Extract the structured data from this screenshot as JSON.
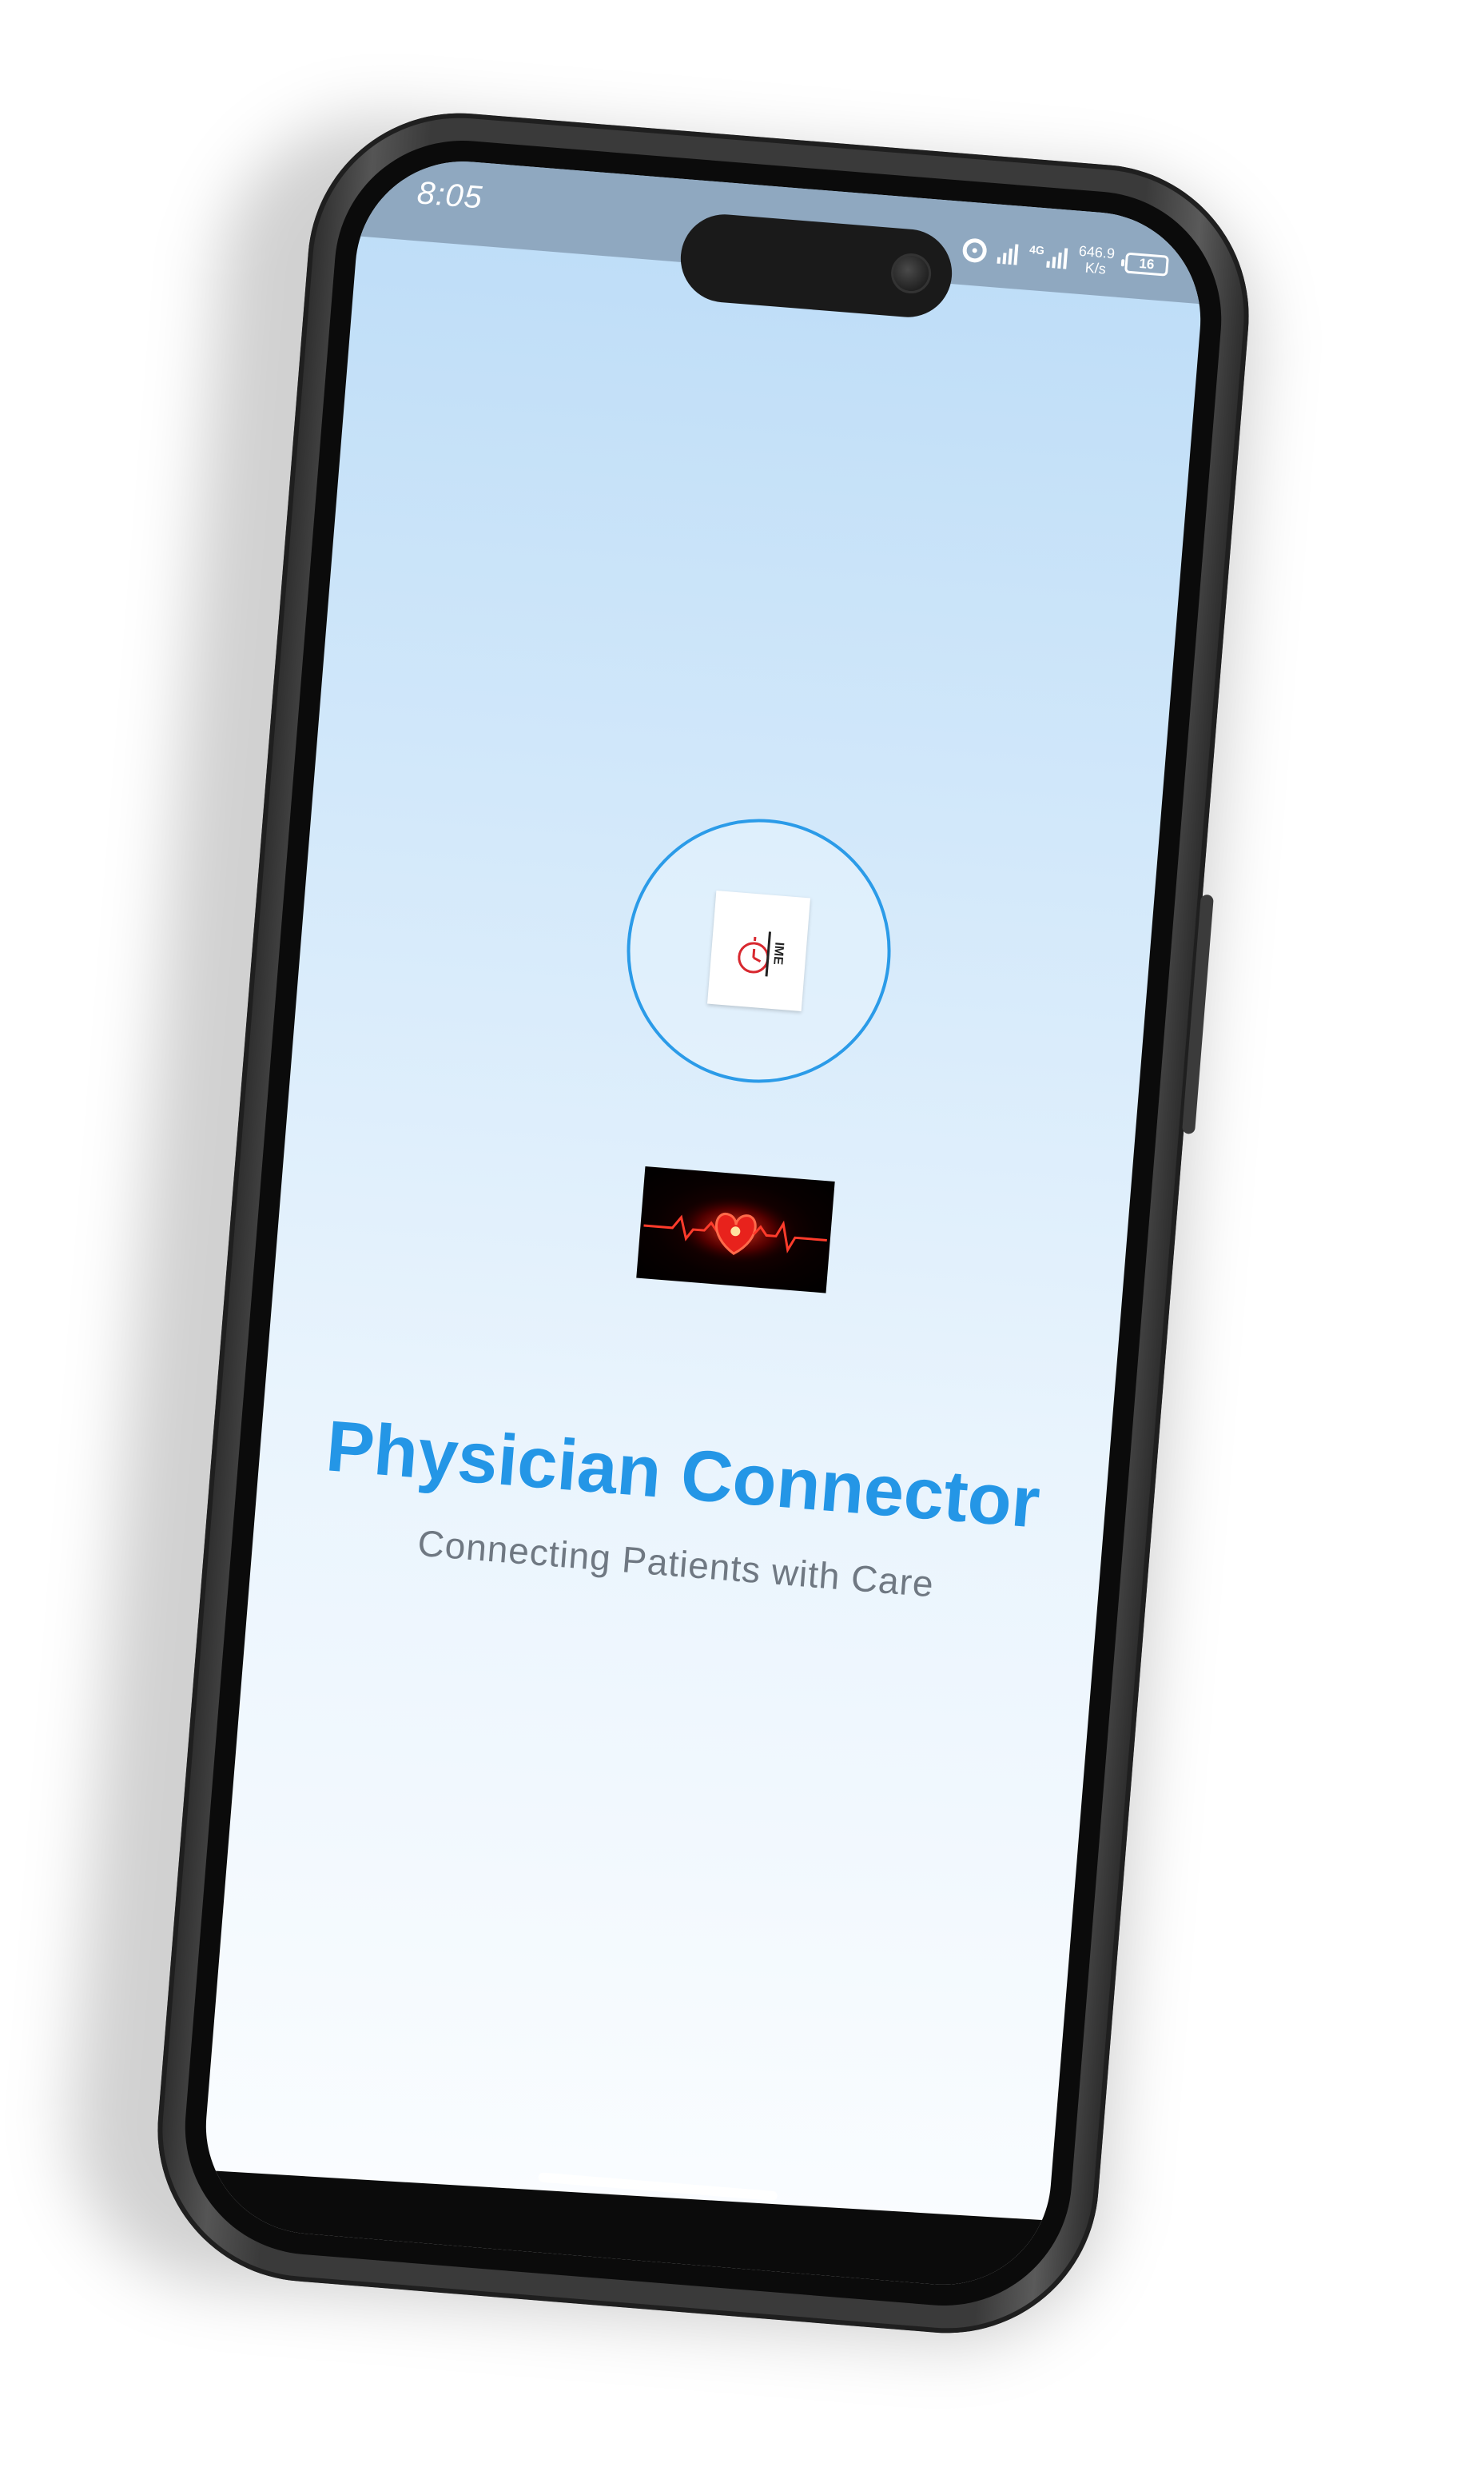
{
  "status_bar": {
    "time": "8:05",
    "network_type": "4G",
    "speed_value": "646.9",
    "speed_unit": "K/s",
    "battery_level": "16"
  },
  "app": {
    "title": "Physician Connector",
    "subtitle": "Connecting Patients with Care",
    "logo_text": "IME"
  },
  "colors": {
    "accent": "#2496e6",
    "subtitle": "#6f7882",
    "logo_ring": "#2b9be8",
    "status_bar": "#8fa8c0"
  },
  "icons": {
    "hotspot": "hotspot-icon",
    "signal": "signal-icon",
    "battery": "battery-icon",
    "camera": "camera-icon",
    "clock": "clock-icon",
    "heartbeat": "heartbeat-icon"
  }
}
